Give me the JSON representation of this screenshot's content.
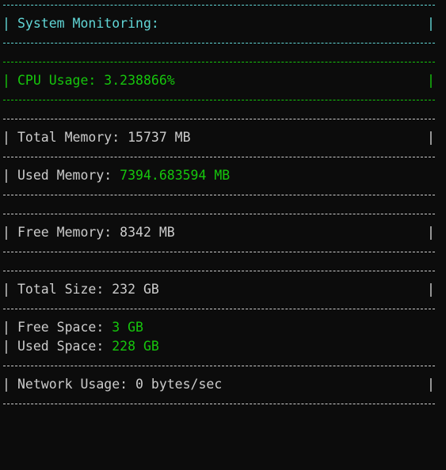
{
  "colors": {
    "background": "#0c0c0c",
    "default_text": "#cccccc",
    "title_text": "#61d6d6",
    "highlight_value": "#16c60c"
  },
  "header": {
    "title": "System Monitoring:"
  },
  "cpu": {
    "label": "CPU Usage:",
    "value": "3.238866%"
  },
  "memory": {
    "total_label": "Total Memory:",
    "total_value": "15737 MB",
    "used_label": "Used Memory:",
    "used_value": "7394.683594 MB",
    "free_label": "Free Memory:",
    "free_value": "8342 MB"
  },
  "disk": {
    "total_label": "Total Size:",
    "total_value": "232 GB",
    "free_label": "Free Space:",
    "free_value": "3 GB",
    "used_label": "Used Space:",
    "used_value": "228 GB"
  },
  "network": {
    "label": "Network Usage:",
    "value": "0 bytes/sec"
  },
  "border_glyph": "|"
}
